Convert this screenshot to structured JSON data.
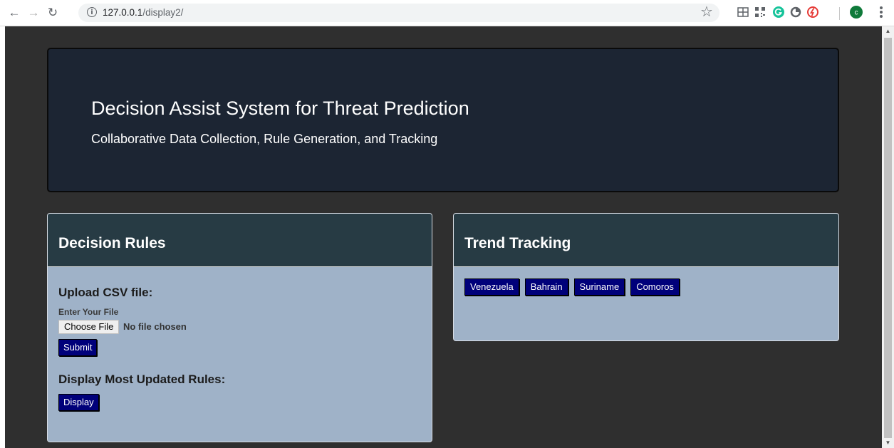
{
  "browser": {
    "url_host": "127.0.0.1",
    "url_path": "/display2/",
    "profile_initial": "c",
    "accent_color": "#0f9d58"
  },
  "hero": {
    "title": "Decision Assist System for Threat Prediction",
    "subtitle": "Collaborative Data Collection, Rule Generation, and Tracking"
  },
  "decision_rules": {
    "title": "Decision Rules",
    "upload_title": "Upload CSV file:",
    "enter_label": "Enter Your File",
    "choose_file_label": "Choose File",
    "no_file_text": "No file chosen",
    "submit_label": "Submit",
    "display_title": "Display Most Updated Rules:",
    "display_label": "Display"
  },
  "trend_tracking": {
    "title": "Trend Tracking",
    "countries": [
      "Venezuela",
      "Bahrain",
      "Suriname",
      "Comoros"
    ]
  },
  "colors": {
    "page_bg": "#2f2f2f",
    "hero_bg": "#1c2533",
    "panel_head": "#273b44",
    "panel_body": "#9fb2c8",
    "button_bg": "#00007a"
  }
}
